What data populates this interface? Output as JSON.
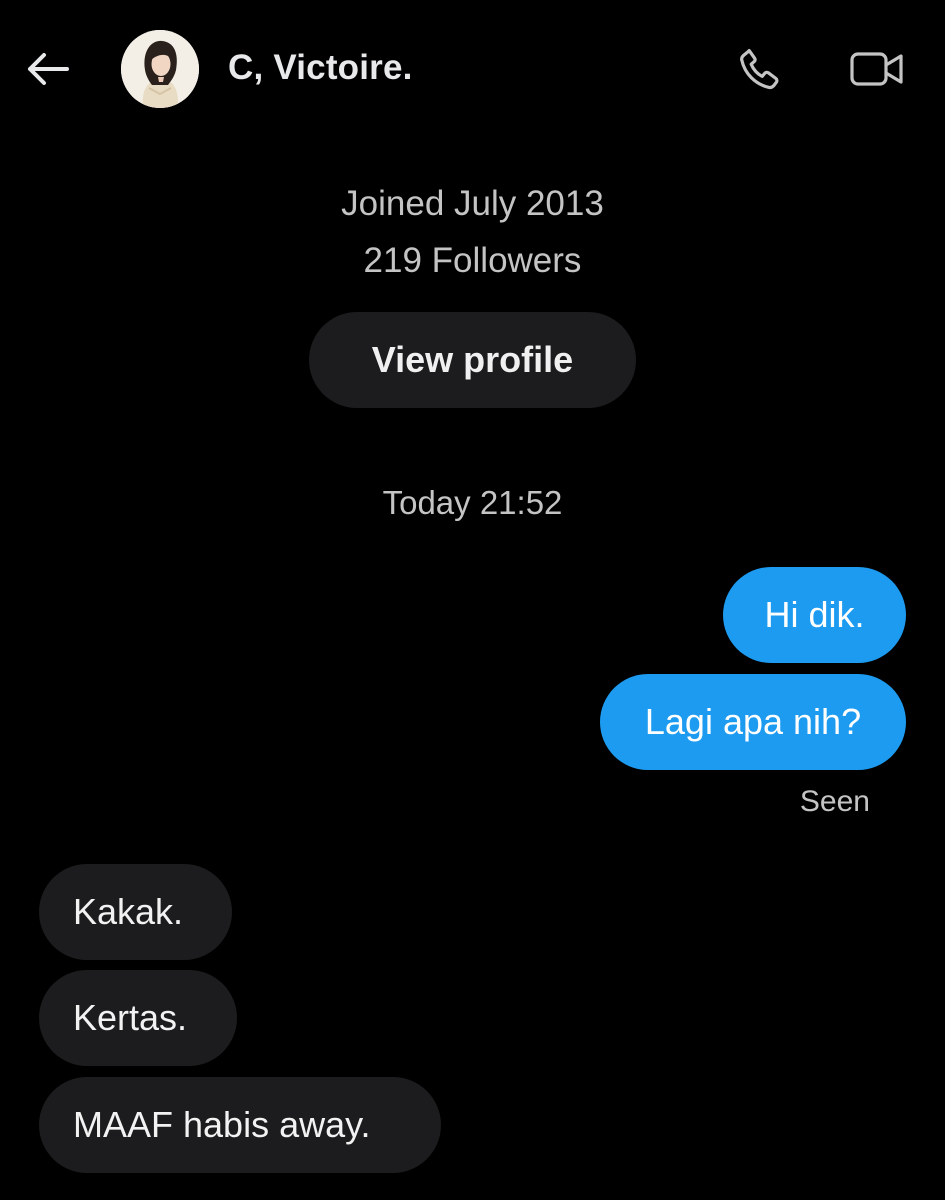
{
  "header": {
    "title": "C, Victoire.",
    "back_icon": "arrow-left-icon",
    "phone_icon": "phone-icon",
    "video_icon": "video-camera-icon"
  },
  "profile": {
    "joined": "Joined July 2013",
    "followers": "219 Followers",
    "view_profile_label": "View profile"
  },
  "conversation": {
    "timestamp": "Today 21:52",
    "outgoing": [
      {
        "text": "Hi dik."
      },
      {
        "text": "Lagi apa nih?"
      }
    ],
    "seen_label": "Seen",
    "incoming": [
      {
        "text": "Kakak."
      },
      {
        "text": "Kertas."
      },
      {
        "text": "MAAF habis away."
      }
    ]
  },
  "colors": {
    "background": "#000000",
    "outgoing_bubble": "#1d9bf0",
    "incoming_bubble": "#1c1c1e",
    "muted_text": "#c4c4c4"
  }
}
